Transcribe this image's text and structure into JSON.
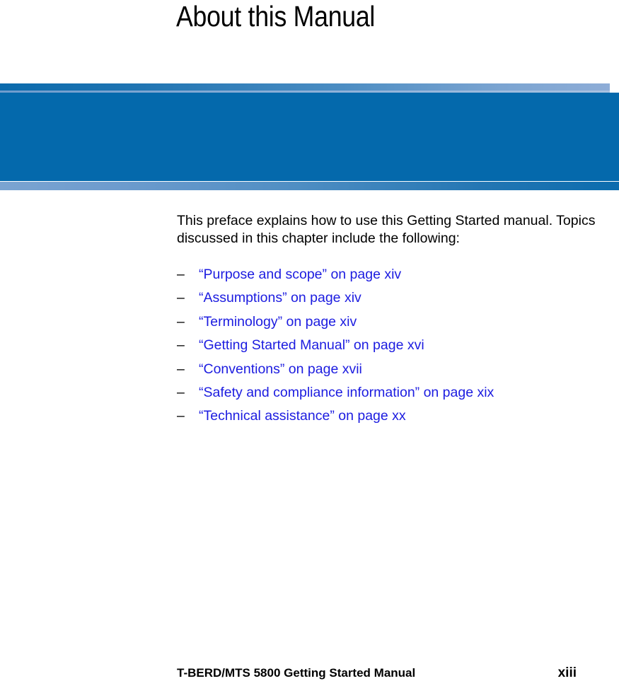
{
  "page": {
    "chapter_title": "About this Manual",
    "intro_paragraph": "This preface explains how to use this Getting Started manual. Topics discussed in this chapter include the following:",
    "bullet_dash": "–",
    "topics": [
      {
        "label": "“Purpose and scope” on page xiv"
      },
      {
        "label": "“Assumptions” on page xiv"
      },
      {
        "label": "“Terminology” on page xiv"
      },
      {
        "label": "“Getting Started Manual” on page xvi"
      },
      {
        "label": "“Conventions” on page xvii"
      },
      {
        "label": "“Safety and compliance information” on page xix"
      },
      {
        "label": "“Technical assistance” on page xx"
      }
    ],
    "footer": {
      "manual_name": "T-BERD/MTS 5800 Getting Started Manual",
      "page_number": "xiii"
    },
    "colors": {
      "banner_blue": "#0469ac",
      "banner_light_blue": "#8eadd7",
      "link_blue": "#1c1ce0",
      "text_black": "#000000"
    }
  }
}
